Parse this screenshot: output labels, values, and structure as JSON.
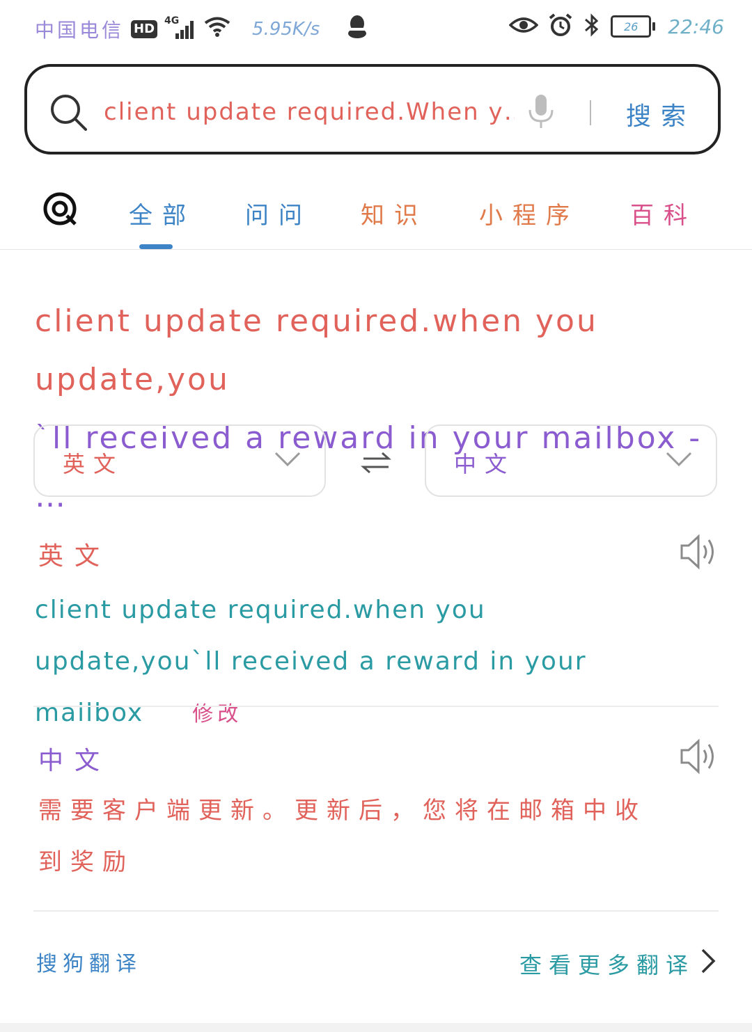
{
  "status_bar": {
    "carrier": "中国电信",
    "hd": "HD",
    "network": "4G",
    "speed": "5.95K/s",
    "battery": "26",
    "time": "22:46"
  },
  "search": {
    "query": "client update required.When y…",
    "button_label": "搜索"
  },
  "tabs": [
    {
      "label": "全部",
      "active": true
    },
    {
      "label": "问问"
    },
    {
      "label": "知识"
    },
    {
      "label": "小程序"
    },
    {
      "label": "百科"
    }
  ],
  "result": {
    "title_line1": "client update required.when you update,you",
    "title_line2": "`ll received a reward in your mailbox - …"
  },
  "translator": {
    "source_lang": "英文",
    "target_lang": "中文",
    "source_label": "英文",
    "source_text": "client update required.when you update,you`ll received a reward in your mailbox",
    "edit_label": "修改",
    "target_label": "中文",
    "target_text": "需要客户端更新。更新后，您将在邮箱中收到奖励",
    "provider": "搜狗翻译",
    "more_link": "查看更多翻译"
  },
  "colors": {
    "accent": "#3d84c6",
    "teal": "#2a9aa3",
    "pink": "#d94f8a",
    "red": "#e0625a",
    "purple": "#8a5ccf"
  }
}
